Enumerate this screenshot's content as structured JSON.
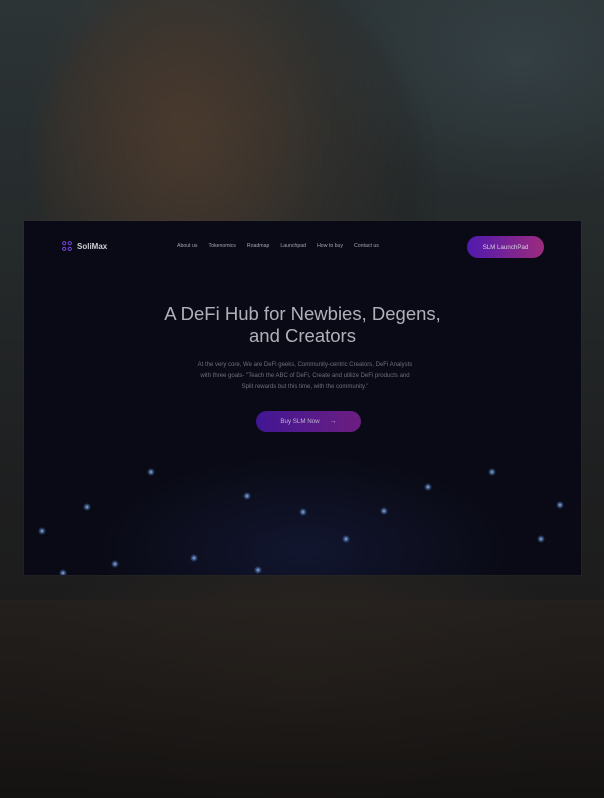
{
  "brand": {
    "name": "SoliMax"
  },
  "nav": {
    "items": [
      {
        "label": "About us"
      },
      {
        "label": "Tokenomics"
      },
      {
        "label": "Roadmap"
      },
      {
        "label": "Launchpad"
      },
      {
        "label": "How to buy"
      },
      {
        "label": "Contact us"
      }
    ],
    "cta_label": "SLM LaunchPad"
  },
  "hero": {
    "title_line1": "A DeFi Hub for Newbies, Degens,",
    "title_line2": "and Creators",
    "description_line1": "At the very core, We are DeFi geeks, Community-centric Creators, DeFi Analysts",
    "description_line2": "with three goals- \"Teach the ABC of DeFi, Create and utilize DeFi products and",
    "description_line3": "Split rewards but this time, with the community.\"",
    "button_label": "Buy SLM Now",
    "button_icon": "arrow-right-icon"
  },
  "colors": {
    "background": "#0b0c18",
    "accent_start": "#5b1ec7",
    "accent_end": "#b2328f",
    "glow": "#6fa8ff"
  }
}
